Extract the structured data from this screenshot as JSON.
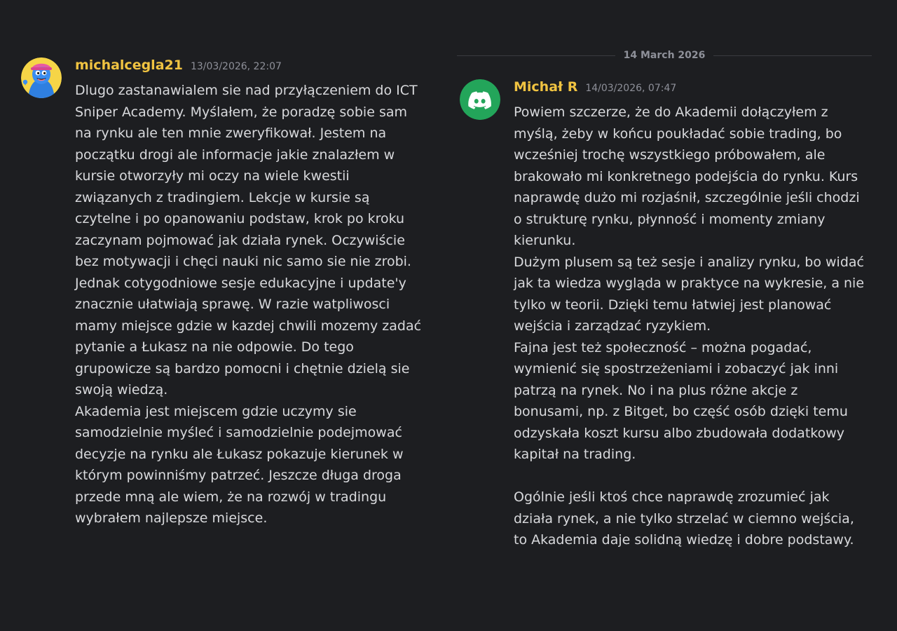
{
  "divider": {
    "date": "14 March 2026"
  },
  "messages": [
    {
      "username": "michalcegla21",
      "timestamp": "13/03/2026, 22:07",
      "avatar_icon": "cartoon-avatar-icon",
      "lines": [
        "Dlugo zastanawialem sie nad przyłączeniem do ICT",
        "Sniper Academy. Myślałem, że poradzę sobie sam",
        "na rynku ale ten mnie zweryfikował. Jestem na",
        "początku drogi ale informacje jakie znalazłem w",
        "kursie otworzyły mi oczy na wiele kwestii",
        "związanych z tradingiem. Lekcje w kursie są",
        "czytelne i po opanowaniu podstaw, krok po kroku",
        "zaczynam pojmować jak działa rynek. Oczywiście",
        "bez motywacji i chęci nauki nic samo sie nie zrobi.",
        "Jednak cotygodniowe sesje edukacyjne i update'y",
        "znacznie ułatwiają sprawę. W razie watpliwosci",
        "mamy miejsce gdzie w kazdej chwili mozemy zadać",
        "pytanie a Łukasz na nie odpowie. Do tego",
        "grupowicze są bardzo pomocni i chętnie dzielą sie",
        "swoją wiedzą.",
        "Akademia jest miejscem gdzie uczymy sie",
        "samodzielnie myśleć i samodzielnie podejmować",
        "decyzje na rynku ale Łukasz pokazuje kierunek w",
        "którym powinniśmy patrzeć. Jeszcze długa droga",
        "przede mną ale wiem, że na rozwój w tradingu",
        "wybrałem najlepsze miejsce."
      ]
    },
    {
      "username": "Michał R",
      "timestamp": "14/03/2026, 07:47",
      "avatar_icon": "discord-logo-icon",
      "lines": [
        "Powiem szczerze, że do Akademii dołączyłem z",
        "myślą, żeby w końcu poukładać sobie trading, bo",
        "wcześniej trochę wszystkiego próbowałem, ale",
        "brakowało mi konkretnego podejścia do rynku. Kurs",
        "naprawdę dużo mi rozjaśnił, szczególnie jeśli chodzi",
        "o strukturę rynku, płynność i momenty zmiany",
        "kierunku.",
        "Dużym plusem są też sesje i analizy rynku, bo widać",
        "jak ta wiedza wygląda w praktyce na wykresie, a nie",
        "tylko w teorii. Dzięki temu łatwiej jest planować",
        "wejścia i zarządzać ryzykiem.",
        "Fajna jest też społeczność – można pogadać,",
        "wymienić się spostrzeżeniami i zobaczyć jak inni",
        "patrzą na rynek. No i na plus różne akcje z",
        "bonusami, np. z Bitget, bo część osób dzięki temu",
        "odzyskała koszt kursu albo zbudowała dodatkowy",
        "kapitał na trading.",
        "",
        "Ogólnie jeśli ktoś chce naprawdę zrozumieć jak",
        "działa rynek, a nie tylko strzelać w ciemno wejścia,",
        "to Akademia daje solidną wiedzę i dobre podstawy."
      ]
    }
  ],
  "colors": {
    "background": "#1d1e21",
    "username": "#f0c341",
    "timestamp": "#8e9099",
    "body_text": "#d8d9dc",
    "discord_green": "#23a55a"
  }
}
